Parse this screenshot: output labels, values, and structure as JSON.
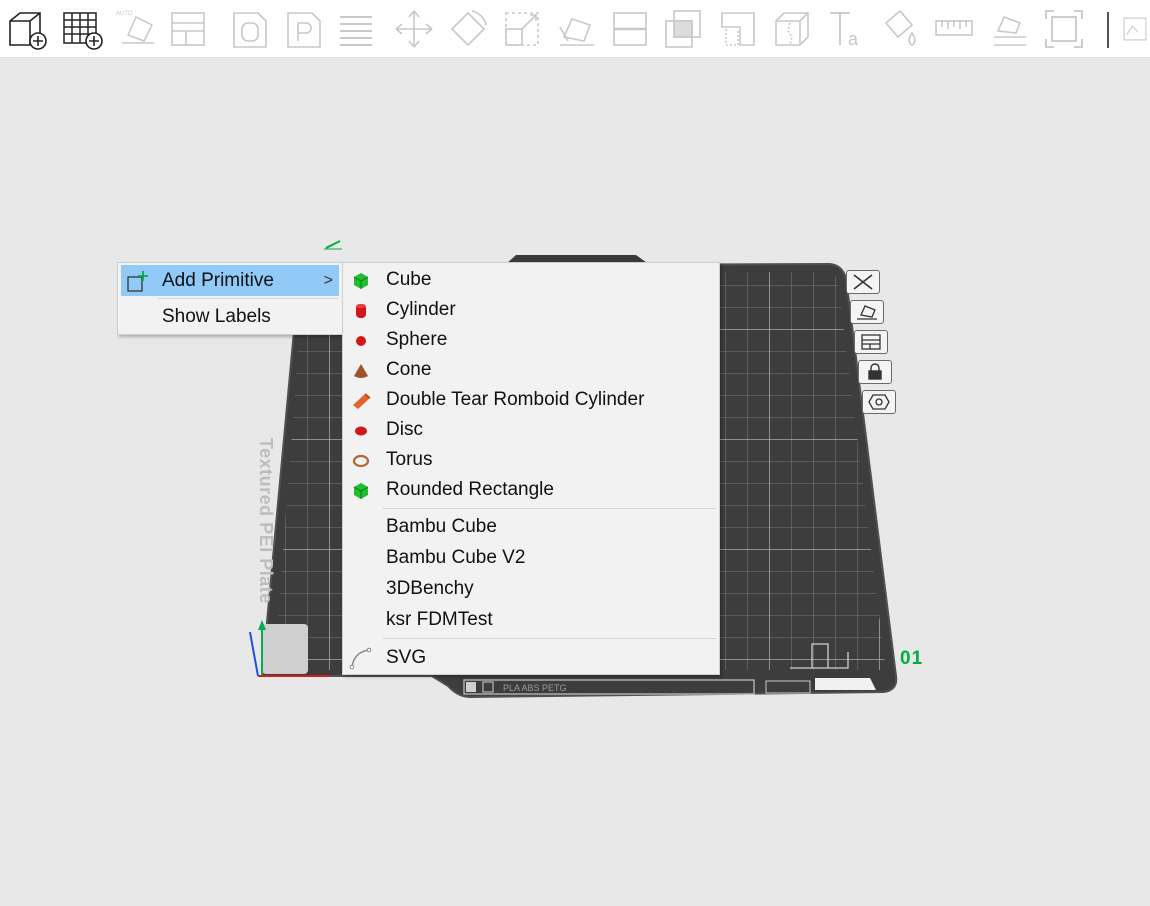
{
  "toolbar": {
    "icons": [
      "add-object-icon",
      "add-plate-icon",
      "auto-orient-icon",
      "arrange-icon",
      "split-objects-icon",
      "split-parts-icon",
      "layers-icon",
      "move-icon",
      "rotate-icon",
      "scale-icon",
      "lay-on-face-icon",
      "cut-icon",
      "boolean-icon",
      "support-paint-icon",
      "seam-paint-icon",
      "text-icon",
      "color-paint-icon",
      "measure-icon",
      "assembly-icon",
      "fit-view-icon"
    ],
    "accent_color": "#00ae42"
  },
  "plate": {
    "label": "Textured PEI Plate",
    "number": "01",
    "footer_text": "PLA ABS PETG"
  },
  "context_menu": {
    "items": [
      {
        "label": "Add Primitive",
        "icon": "add-primitive-icon",
        "has_submenu": true,
        "highlighted": true
      },
      {
        "label": "Show Labels",
        "icon": "",
        "has_submenu": false,
        "highlighted": false
      }
    ],
    "submenu_arrow": ">"
  },
  "submenu": {
    "primitives": [
      {
        "label": "Cube",
        "icon": "cube-icon"
      },
      {
        "label": "Cylinder",
        "icon": "cylinder-icon"
      },
      {
        "label": "Sphere",
        "icon": "sphere-icon"
      },
      {
        "label": "Cone",
        "icon": "cone-icon"
      },
      {
        "label": "Double Tear Romboid Cylinder",
        "icon": "romboid-cylinder-icon"
      },
      {
        "label": "Disc",
        "icon": "disc-icon"
      },
      {
        "label": "Torus",
        "icon": "torus-icon"
      },
      {
        "label": "Rounded Rectangle",
        "icon": "rounded-rectangle-icon"
      }
    ],
    "models": [
      {
        "label": "Bambu Cube"
      },
      {
        "label": "Bambu Cube V2"
      },
      {
        "label": "3DBenchy"
      },
      {
        "label": "ksr FDMTest"
      }
    ],
    "svg_item": {
      "label": "SVG",
      "icon": "svg-curve-icon"
    }
  }
}
